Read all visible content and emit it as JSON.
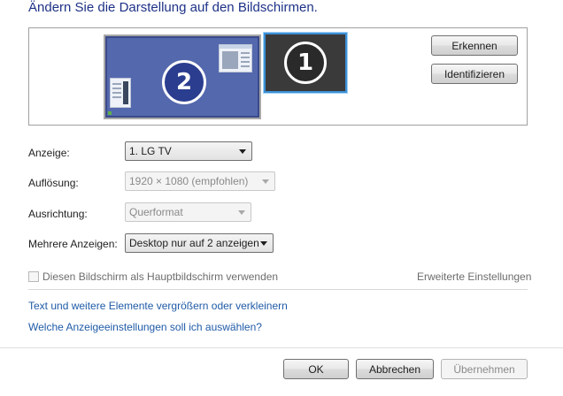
{
  "header": {
    "title": "Ändern Sie die Darstellung auf den Bildschirmen."
  },
  "preview": {
    "monitors": [
      {
        "number": "2",
        "state": "inactive"
      },
      {
        "number": "1",
        "state": "selected"
      }
    ],
    "detect_label": "Erkennen",
    "identify_label": "Identifizieren"
  },
  "settings": {
    "display": {
      "label": "Anzeige:",
      "value": "1. LG TV"
    },
    "resolution": {
      "label": "Auflösung:",
      "value": "1920 × 1080 (empfohlen)"
    },
    "orientation": {
      "label": "Ausrichtung:",
      "value": "Querformat"
    },
    "multiple": {
      "label": "Mehrere Anzeigen:",
      "value": "Desktop nur auf 2 anzeigen"
    },
    "primary_checkbox_label": "Diesen Bildschirm als Hauptbildschirm verwenden",
    "advanced_link": "Erweiterte Einstellungen"
  },
  "links": {
    "resize_text": "Text und weitere Elemente vergrößern oder verkleinern",
    "which_settings": "Welche Anzeigeeinstellungen soll ich auswählen?"
  },
  "footer": {
    "ok": "OK",
    "cancel": "Abbrechen",
    "apply": "Übernehmen"
  },
  "colors": {
    "title": "#1e3287",
    "link": "#1f5ba7",
    "monitor_selected_border": "#3c8fd6"
  }
}
